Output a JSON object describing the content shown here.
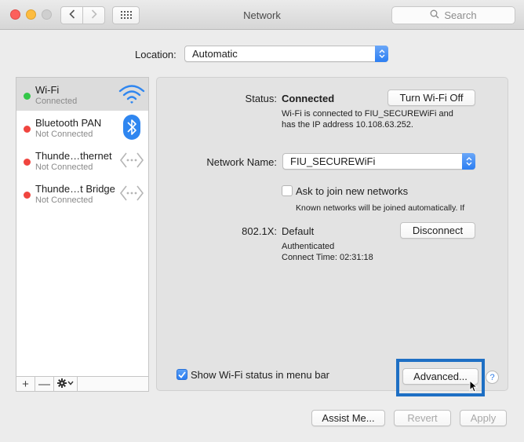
{
  "window": {
    "title": "Network"
  },
  "search": {
    "placeholder": "Search"
  },
  "location": {
    "label": "Location:",
    "value": "Automatic"
  },
  "services": [
    {
      "name": "Wi-Fi",
      "status": "Connected",
      "dot": "#33c748",
      "icon": "wifi-icon"
    },
    {
      "name": "Bluetooth PAN",
      "status": "Not Connected",
      "dot": "#f0453f",
      "icon": "bluetooth-icon"
    },
    {
      "name": "Thunde…thernet",
      "status": "Not Connected",
      "dot": "#f0453f",
      "icon": "thunderbolt-icon"
    },
    {
      "name": "Thunde…t Bridge",
      "status": "Not Connected",
      "dot": "#f0453f",
      "icon": "thunderbolt-icon"
    }
  ],
  "list_tools": {
    "add": "+",
    "remove": "—"
  },
  "detail": {
    "status_label": "Status:",
    "status_value": "Connected",
    "turn_off_button": "Turn Wi-Fi Off",
    "status_desc_1": "Wi-Fi is connected to FIU_SECUREWiFi and",
    "status_desc_2": "has the IP address 10.108.63.252.",
    "network_name_label": "Network Name:",
    "network_name_value": "FIU_SECUREWiFi",
    "ask_join_label": "Ask to join new networks",
    "ask_join_checked": false,
    "ask_join_note": "Known networks will be joined automatically. If",
    "dot1x_label": "802.1X:",
    "dot1x_value": "Default",
    "disconnect_button": "Disconnect",
    "auth_line_1": "Authenticated",
    "auth_line_2": "Connect Time: 02:31:18",
    "show_status_label": "Show Wi-Fi status in menu bar",
    "show_status_checked": true,
    "advanced_button": "Advanced...",
    "help_label": "?"
  },
  "footer": {
    "assist_button": "Assist Me...",
    "revert_button": "Revert",
    "apply_button": "Apply"
  },
  "colors": {
    "accent": "#2a7cf0",
    "highlight": "#1e6fc4"
  }
}
